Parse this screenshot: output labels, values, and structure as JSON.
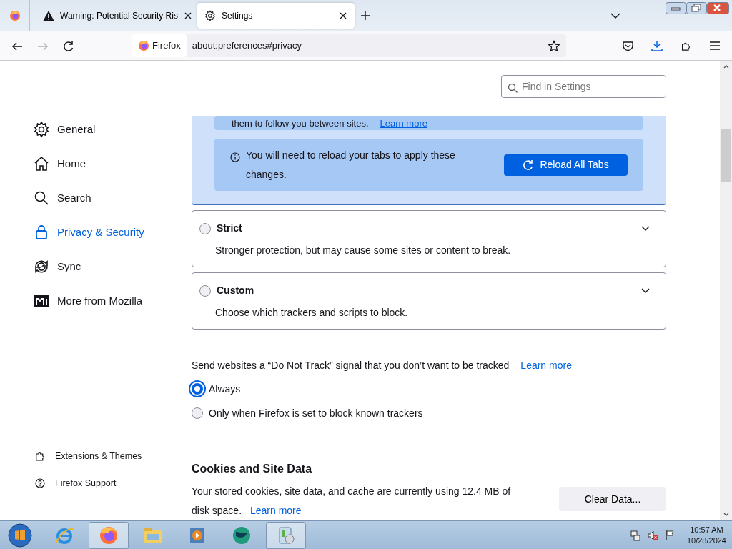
{
  "browser": {
    "tabs": [
      {
        "kind": "warning",
        "title": "Warning: Potential Security Ris",
        "selected": false
      },
      {
        "kind": "settings",
        "title": "Settings",
        "selected": true
      }
    ],
    "identity": "Firefox",
    "url": "about:preferences#privacy"
  },
  "search": {
    "placeholder": "Find in Settings"
  },
  "sidebar": {
    "items": [
      {
        "kind": "gear",
        "label": "General",
        "selected": false
      },
      {
        "kind": "home",
        "label": "Home",
        "selected": false
      },
      {
        "kind": "search",
        "label": "Search",
        "selected": false
      },
      {
        "kind": "lock",
        "label": "Privacy & Security",
        "selected": true
      },
      {
        "kind": "sync",
        "label": "Sync",
        "selected": false
      },
      {
        "kind": "mozilla",
        "label": "More from Mozilla",
        "selected": false
      }
    ],
    "footer": [
      {
        "kind": "puzzle",
        "label": "Extensions & Themes"
      },
      {
        "kind": "help",
        "label": "Firefox Support"
      }
    ]
  },
  "protection": {
    "selected_panel": {
      "text": "them to follow you between sites.",
      "link": "Learn more",
      "notice": "You will need to reload your tabs to apply these changes.",
      "button": "Reload All Tabs"
    },
    "options": [
      {
        "label": "Strict",
        "description": "Stronger protection, but may cause some sites or content to break.",
        "selected": false,
        "expanded": false
      },
      {
        "label": "Custom",
        "description": "Choose which trackers and scripts to block.",
        "selected": false,
        "expanded": false
      }
    ]
  },
  "dnt": {
    "text": "Send websites a “Do Not Track” signal that you don’t want to be tracked",
    "link": "Learn more",
    "options": [
      {
        "label": "Always",
        "selected": true
      },
      {
        "label": "Only when Firefox is set to block known trackers",
        "selected": false
      }
    ]
  },
  "cookies": {
    "title": "Cookies and Site Data",
    "text": "Your stored cookies, site data, and cache are currently using 12.4 MB of disk space.",
    "link": "Learn more",
    "button": "Clear Data..."
  },
  "taskbar": {
    "apps": [
      {
        "kind": "ie",
        "selected": false
      },
      {
        "kind": "firefox",
        "selected": true
      },
      {
        "kind": "folder",
        "selected": false
      },
      {
        "kind": "media",
        "selected": false
      },
      {
        "kind": "globe",
        "selected": false
      },
      {
        "kind": "control",
        "selected": true
      }
    ],
    "time": "10:57 AM",
    "date": "10/28/2024"
  }
}
